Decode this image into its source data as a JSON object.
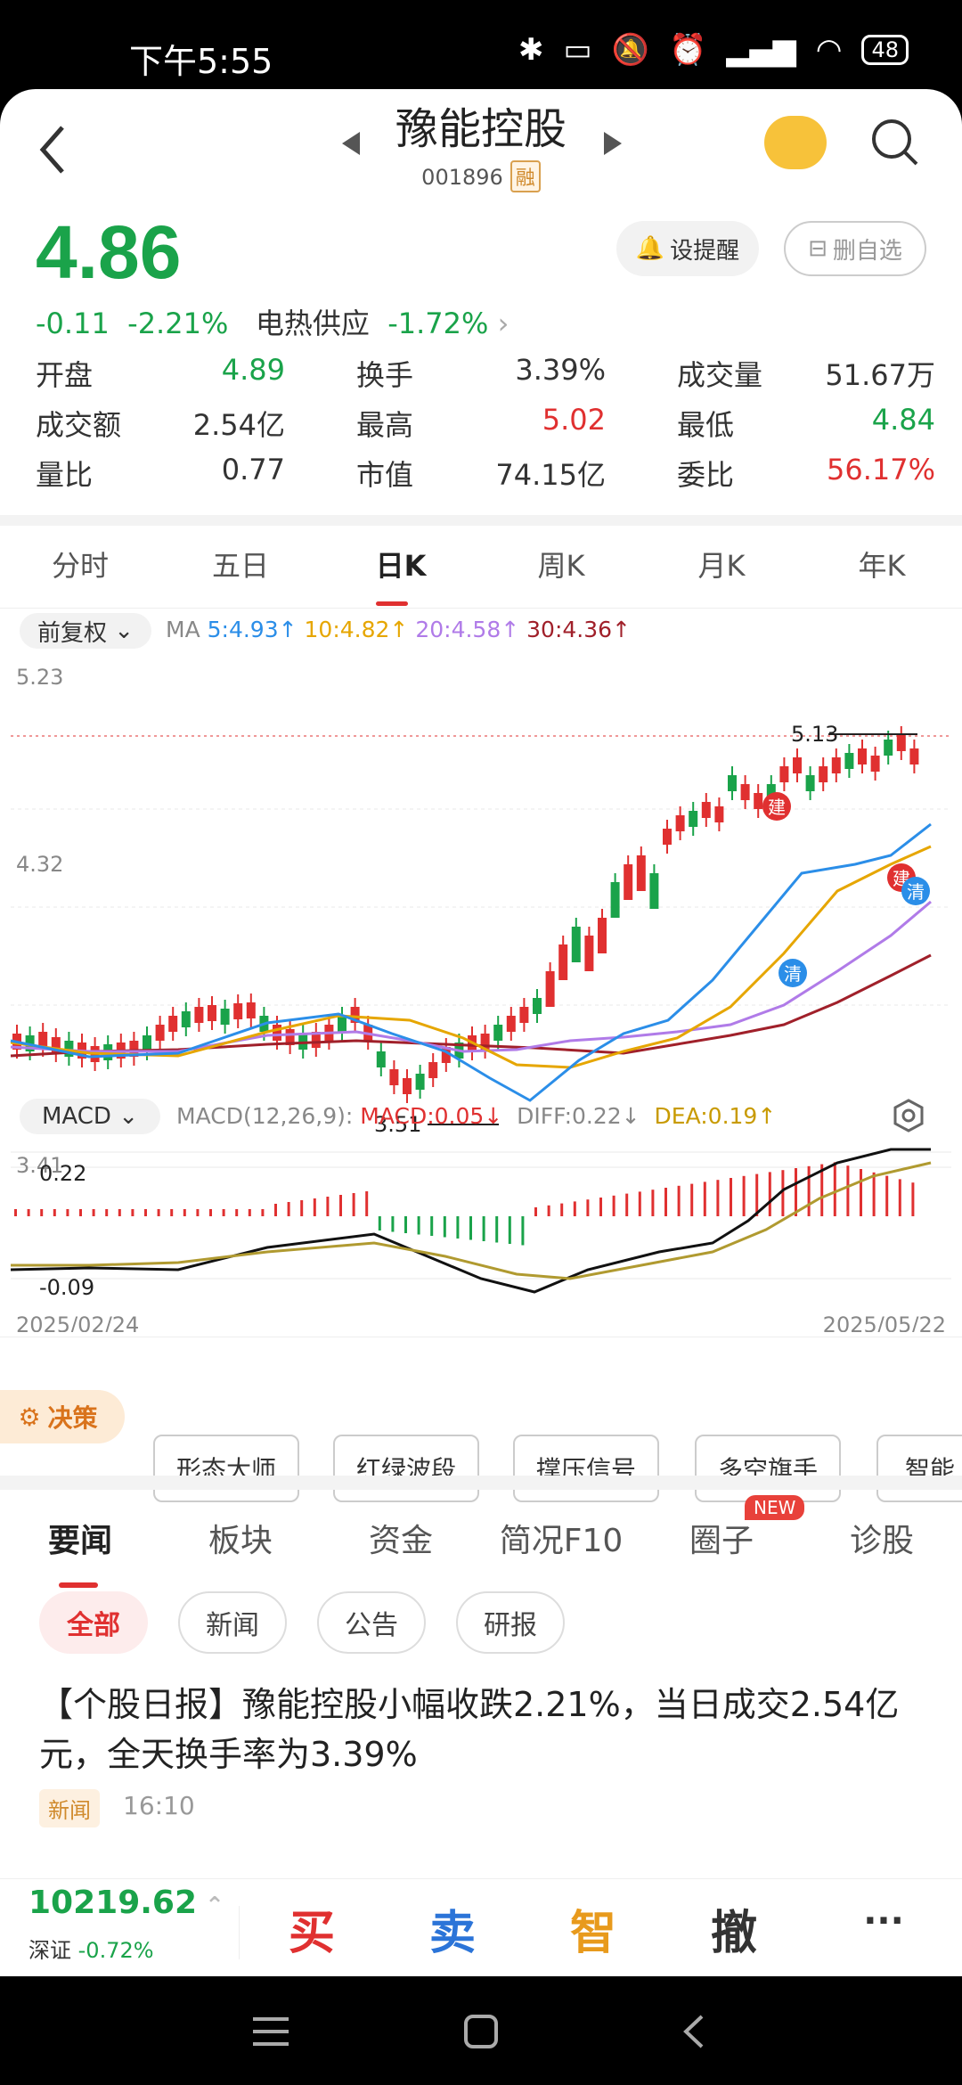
{
  "status": {
    "time": "下午5:55",
    "battery": "48"
  },
  "header": {
    "title": "豫能控股",
    "code": "001896",
    "badge": "融"
  },
  "quote": {
    "price": "4.86",
    "change": "-0.11",
    "change_pct": "-2.21%",
    "sector": "电热供应",
    "sector_pct": "-1.72%",
    "remind": "设提醒",
    "remove": "删自选"
  },
  "stats": [
    {
      "label": "开盘",
      "value": "4.89",
      "color": "#1aa34a"
    },
    {
      "label": "换手",
      "value": "3.39%",
      "color": "#333"
    },
    {
      "label": "成交量",
      "value": "51.67万",
      "color": "#333"
    },
    {
      "label": "成交额",
      "value": "2.54亿",
      "color": "#333"
    },
    {
      "label": "最高",
      "value": "5.02",
      "color": "#e03030"
    },
    {
      "label": "最低",
      "value": "4.84",
      "color": "#1aa34a"
    },
    {
      "label": "量比",
      "value": "0.77",
      "color": "#333"
    },
    {
      "label": "市值",
      "value": "74.15亿",
      "color": "#333"
    },
    {
      "label": "委比",
      "value": "56.17%",
      "color": "#e03030"
    }
  ],
  "ktabs": [
    "分时",
    "五日",
    "日K",
    "周K",
    "月K",
    "年K"
  ],
  "ma": {
    "adjust": "前复权",
    "label": "MA",
    "ma5": "5:4.93↑",
    "ma10": "10:4.82↑",
    "ma20": "20:4.58↑",
    "ma30": "30:4.36↑"
  },
  "chart": {
    "y_top": "5.23",
    "y_mid": "4.32",
    "y_bot": "3.41",
    "high_label": "5.13",
    "low_label": "3.51",
    "marker_build": "建",
    "marker_clear": "清"
  },
  "macd": {
    "name": "MACD",
    "params": "MACD(12,26,9):",
    "macd": "MACD:0.05↓",
    "diff": "DIFF:0.22↓",
    "dea": "DEA:0.19↑",
    "top": "0.22",
    "bot": "-0.09",
    "date_start": "2025/02/24",
    "date_end": "2025/05/22"
  },
  "decision": {
    "label": "决策",
    "buttons": [
      "形态大师",
      "红绿波段",
      "撑压信号",
      "多空旗手",
      "智能"
    ]
  },
  "newstabs": [
    "要闻",
    "板块",
    "资金",
    "简况F10",
    "圈子",
    "诊股"
  ],
  "new_badge": "NEW",
  "filters": [
    "全部",
    "新闻",
    "公告",
    "研报"
  ],
  "news": {
    "title": "【个股日报】豫能控股小幅收跌2.21%，当日成交2.54亿元，全天换手率为3.39%",
    "tag": "新闻",
    "time": "16:10"
  },
  "bottom": {
    "index_value": "10219.62",
    "index_name": "深证",
    "index_pct": "-0.72%",
    "buy": "买",
    "sell": "卖",
    "smart": "智",
    "cancel": "撤",
    "more": "···"
  },
  "chart_data": {
    "type": "candlestick",
    "ylim": [
      3.41,
      5.23
    ],
    "high": 5.13,
    "low": 3.51,
    "x_start": "2025/02/24",
    "x_end": "2025/05/22"
  }
}
